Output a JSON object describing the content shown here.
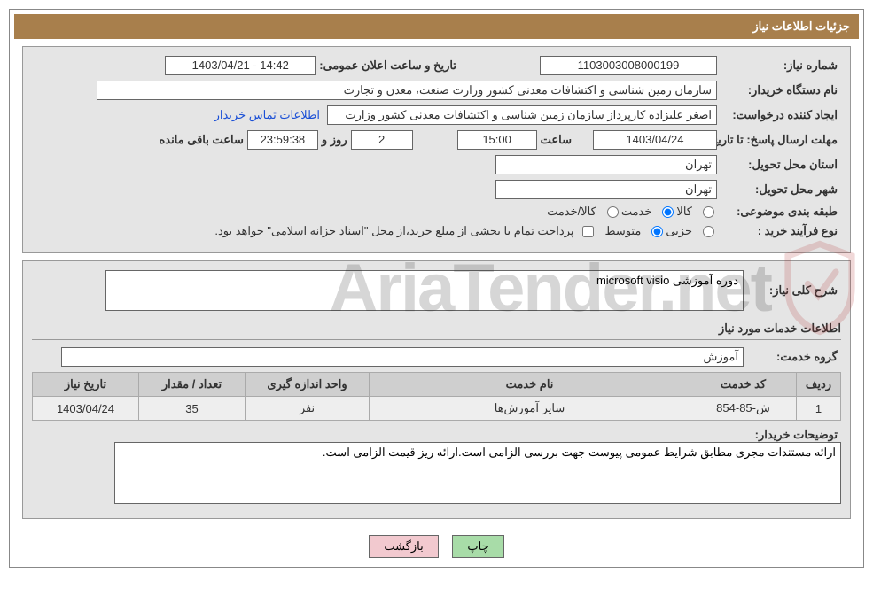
{
  "titleBar": "جزئیات اطلاعات نیاز",
  "fields": {
    "needNoLabel": "شماره نیاز:",
    "needNo": "1103003008000199",
    "announceLabel": "تاریخ و ساعت اعلان عمومی:",
    "announce": "1403/04/21 - 14:42",
    "orgLabel": "نام دستگاه خریدار:",
    "org": "سازمان زمین شناسی و اکتشافات معدنی کشور وزارت صنعت، معدن و تجارت",
    "creatorLabel": "ایجاد کننده درخواست:",
    "creator": "اصغر علیزاده کارپرداز سازمان زمین شناسی و اکتشافات معدنی کشور وزارت صنع",
    "contactLink": "اطلاعات تماس خریدار",
    "deadlineLabel": "مهلت ارسال پاسخ: تا تاریخ:",
    "deadlineDate": "1403/04/24",
    "timeLabel": "ساعت",
    "deadlineTime": "15:00",
    "daysRemain": "2",
    "daysAnd": "روز و",
    "countdown": "23:59:38",
    "remainLabel": "ساعت باقی مانده",
    "provinceLabel": "استان محل تحویل:",
    "province": "تهران",
    "cityLabel": "شهر محل تحویل:",
    "city": "تهران",
    "categoryLabel": "طبقه بندی موضوعی:",
    "catGoods": "کالا",
    "catService": "خدمت",
    "catBoth": "کالا/خدمت",
    "procTypeLabel": "نوع فرآیند خرید :",
    "procSmall": "جزیی",
    "procMedium": "متوسط",
    "procNote": "پرداخت تمام یا بخشی از مبلغ خرید،از محل \"اسناد خزانه اسلامی\" خواهد بود.",
    "descLabel": "شرح کلی نیاز:",
    "desc": "دوره آموزشی microsoft visio",
    "servicesHeading": "اطلاعات خدمات مورد نیاز",
    "serviceGroupLabel": "گروه خدمت:",
    "serviceGroup": "آموزش",
    "buyerNoteLabel": "توضیحات خریدار:",
    "buyerNote": "ارائه مستندات مجری مطابق شرایط عمومی پیوست جهت بررسی الزامی است.ارائه ریز قیمت الزامی است."
  },
  "table": {
    "headers": {
      "row": "ردیف",
      "code": "کد خدمت",
      "name": "نام خدمت",
      "unit": "واحد اندازه گیری",
      "qty": "تعداد / مقدار",
      "date": "تاریخ نیاز"
    },
    "rows": [
      {
        "row": "1",
        "code": "ش-85-854",
        "name": "سایر آموزش‌ها",
        "unit": "نفر",
        "qty": "35",
        "date": "1403/04/24"
      }
    ]
  },
  "buttons": {
    "print": "چاپ",
    "back": "بازگشت"
  },
  "watermark": "AriaTender.net"
}
